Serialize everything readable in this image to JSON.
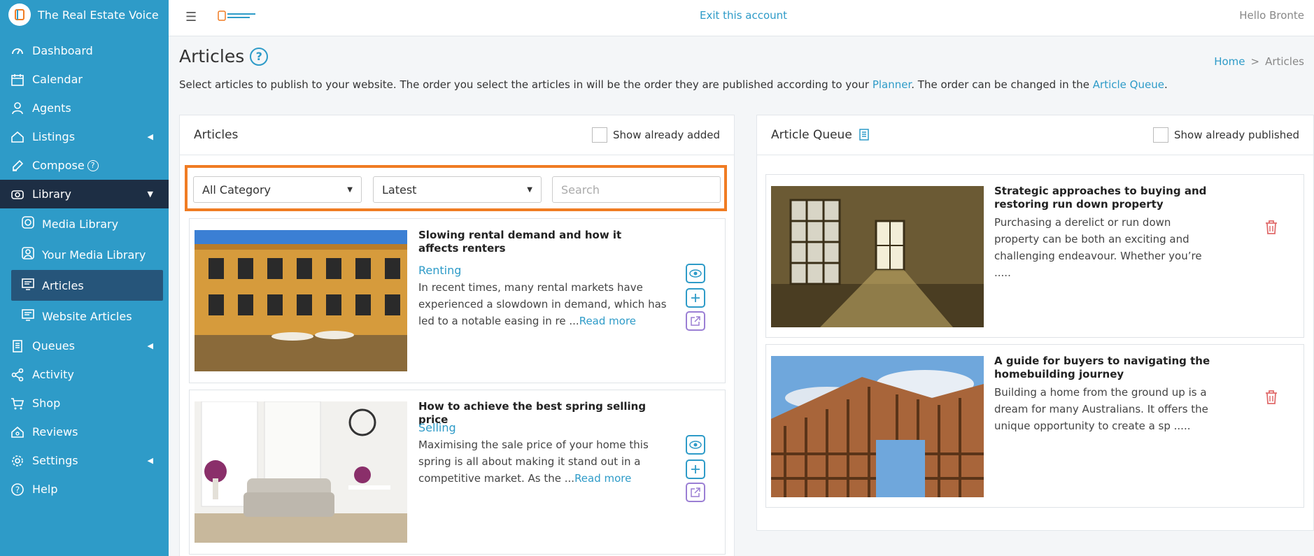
{
  "brand": {
    "title": "The Real Estate Voice"
  },
  "topbar": {
    "exit_label": "Exit this account",
    "greeting": "Hello Bronte"
  },
  "sidebar": {
    "items": [
      {
        "label": "Dashboard",
        "icon": "dashboard-icon"
      },
      {
        "label": "Calendar",
        "icon": "calendar-icon"
      },
      {
        "label": "Agents",
        "icon": "agents-icon"
      },
      {
        "label": "Listings",
        "icon": "listings-icon"
      },
      {
        "label": "Compose",
        "icon": "compose-icon"
      },
      {
        "label": "Library",
        "icon": "library-icon"
      },
      {
        "label": "Media Library",
        "icon": "media-library-icon"
      },
      {
        "label": "Your Media Library",
        "icon": "your-media-library-icon"
      },
      {
        "label": "Articles",
        "icon": "articles-icon"
      },
      {
        "label": "Website Articles",
        "icon": "website-articles-icon"
      },
      {
        "label": "Queues",
        "icon": "queues-icon"
      },
      {
        "label": "Activity",
        "icon": "activity-icon"
      },
      {
        "label": "Shop",
        "icon": "shop-icon"
      },
      {
        "label": "Reviews",
        "icon": "reviews-icon"
      },
      {
        "label": "Settings",
        "icon": "settings-icon"
      },
      {
        "label": "Help",
        "icon": "help-icon"
      }
    ]
  },
  "page": {
    "title": "Articles",
    "breadcrumb": {
      "home": "Home",
      "separator": ">",
      "current": "Articles"
    },
    "intro": {
      "part1": "Select articles to publish to your website. The order you select the articles in will be the order they are published according to your ",
      "planner_link": "Planner",
      "part2": ". The order can be changed in the ",
      "queue_link": "Article Queue",
      "part3": "."
    }
  },
  "articles_panel": {
    "title": "Articles",
    "show_added_label": "Show already added",
    "category_select": "All Category",
    "sort_select": "Latest",
    "search_placeholder": "Search",
    "read_more": "Read more",
    "cards": [
      {
        "title": "Slowing rental demand and how it affects renters",
        "category": "Renting",
        "excerpt": "In recent times, many rental markets have experienced a slowdown in demand, which has led to a notable easing in re ..."
      },
      {
        "title": "How to achieve the best spring selling price",
        "category": "Selling",
        "excerpt": "Maximising the sale price of your home this spring is all about making it stand out in a competitive market. As the ..."
      }
    ]
  },
  "queue_panel": {
    "title": "Article Queue",
    "show_published_label": "Show already published",
    "items": [
      {
        "title": "Strategic approaches to buying and restoring run down property",
        "excerpt": "Purchasing a derelict or run down property can be both an exciting and challenging endeavour. Whether you’re ....."
      },
      {
        "title": "A guide for buyers to navigating the homebuilding journey",
        "excerpt": "Building a home from the ground up is a dream for many Australians. It offers the unique opportunity to create a sp ....."
      }
    ]
  },
  "colors": {
    "sidebar": "#2e9bc8",
    "active_nav": "#1d2e44",
    "accent": "#2e9bc8",
    "highlight": "#f07c23",
    "delete": "#e06b6b"
  }
}
